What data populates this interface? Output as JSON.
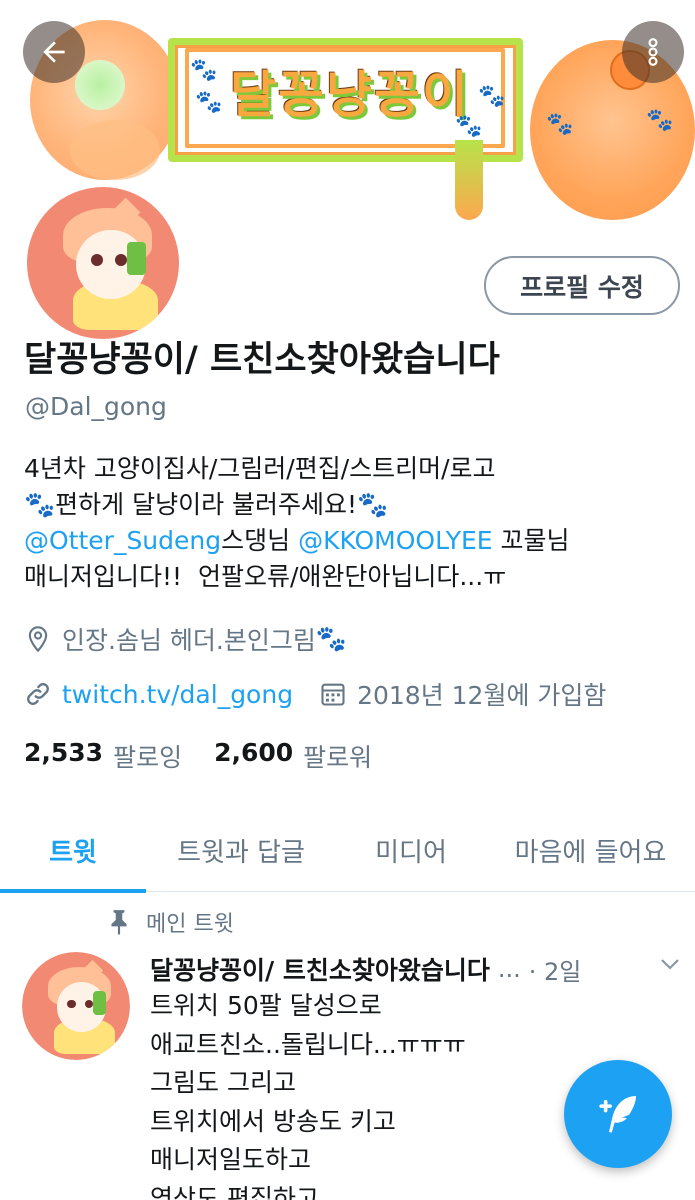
{
  "header": {
    "banner_text": "달꽁냥꽁이",
    "back_icon": "arrow-left-icon",
    "more_icon": "more-vertical-icon"
  },
  "profile": {
    "edit_button_label": "프로필 수정",
    "display_name": "달꽁냥꽁이/ 트친소찾아왔습니다",
    "handle": "@Dal_gong",
    "bio": {
      "line1": "4년차 고양이집사/그림러/편집/스트리머/로고",
      "line2_paw_left": "🐾",
      "line2_text": "편하게 달냥이라 불러주세요!",
      "line2_paw_right": "🐾",
      "line3_mention1": "@Otter_Sudeng",
      "line3_text1": "스댕님 ",
      "line3_mention2": "@KKOMOOLYEE",
      "line3_text2": " 꼬물님",
      "line4": "매니저입니다!!  언팔오류/애완단아닙니다...ㅠ"
    },
    "location": "인장.솜님 헤더.본인그림",
    "location_paw": "🐾",
    "website": "twitch.tv/dal_gong",
    "joined": "2018년 12월에 가입함",
    "following_count": "2,533",
    "following_label": "팔로잉",
    "followers_count": "2,600",
    "followers_label": "팔로워"
  },
  "tabs": [
    {
      "label": "트윗",
      "active": true
    },
    {
      "label": "트윗과 답글",
      "active": false
    },
    {
      "label": "미디어",
      "active": false
    },
    {
      "label": "마음에 들어요",
      "active": false
    }
  ],
  "pinned_tweet": {
    "pinned_label": "메인 트윗",
    "author_name": "달꽁냥꽁이/ 트친소찾아왔습니다",
    "ellipsis": "...",
    "time": "· 2일",
    "lines": [
      "트위치 50팔 달성으로",
      "애교트친소..돌립니다...ㅠㅠㅠ",
      "그림도 그리고",
      "트위치에서 방송도 키고",
      "매니저일도하고",
      "영상도 편집하고"
    ]
  },
  "colors": {
    "accent": "#1da1f2",
    "secondary_text": "#657786",
    "primary_text": "#14171a",
    "border": "#e1e8ed"
  },
  "fab_icon": "compose-tweet-icon"
}
